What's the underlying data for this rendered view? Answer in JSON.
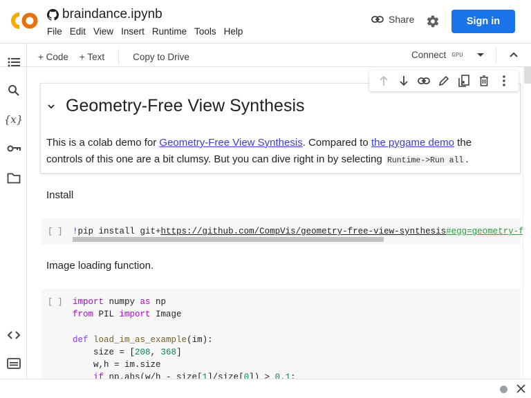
{
  "header": {
    "logo": "colab-logo",
    "notebook_title": "braindance.ipynb",
    "menu": [
      "File",
      "Edit",
      "View",
      "Insert",
      "Runtime",
      "Tools",
      "Help"
    ],
    "share_label": "Share",
    "signin_label": "Sign in",
    "brand_color": "#1a73e8",
    "logo_color": "#f9ab00"
  },
  "toolbar": {
    "add_code": "+ Code",
    "add_text": "+ Text",
    "copy_to_drive": "Copy to Drive",
    "connect": "Connect",
    "runtime_type": "GPU"
  },
  "sidebar": {
    "icons": [
      "table-of-contents-icon",
      "search-icon",
      "variables-icon",
      "secrets-key-icon",
      "files-folder-icon"
    ],
    "bottom_icons": [
      "code-snippets-icon",
      "command-palette-icon"
    ],
    "variables_glyph": "{x}"
  },
  "cell_toolbar": {
    "icons": [
      "move-up-icon",
      "move-down-icon",
      "link-icon",
      "edit-icon",
      "mirror-cell-icon",
      "delete-icon",
      "more-options-icon"
    ]
  },
  "cells": {
    "intro": {
      "heading": "Geometry-Free View Synthesis",
      "text_1": "This is a colab demo for ",
      "link_1": "Geometry-Free View Synthesis",
      "text_2": ". Compared to ",
      "link_2": "the pygame demo",
      "text_3": " the controls of this one are a bit clumsy. But you can dive right in by selecting ",
      "code": "Runtime->Run all",
      "text_4": "."
    },
    "install_label": "Install",
    "install_cell": {
      "bracket": "[ ]",
      "bang": "!",
      "cmd": "pip install git+",
      "url": "https://github.com/CompVis/geometry-free-view-synthesis",
      "fragment": "#egg=geometry-free-view-synthesis"
    },
    "image_label": "Image loading function.",
    "image_cell": {
      "bracket": "[ ]",
      "lines": [
        "import numpy as np",
        "from PIL import Image",
        "",
        "def load_im_as_example(im):",
        "    size = [208, 368]",
        "    w,h = im.size",
        "    if np.abs(w/h - size[1]/size[0]) > 0.1:"
      ]
    }
  },
  "statusbar": {
    "status": "disconnected",
    "close_icon": "close-icon"
  }
}
